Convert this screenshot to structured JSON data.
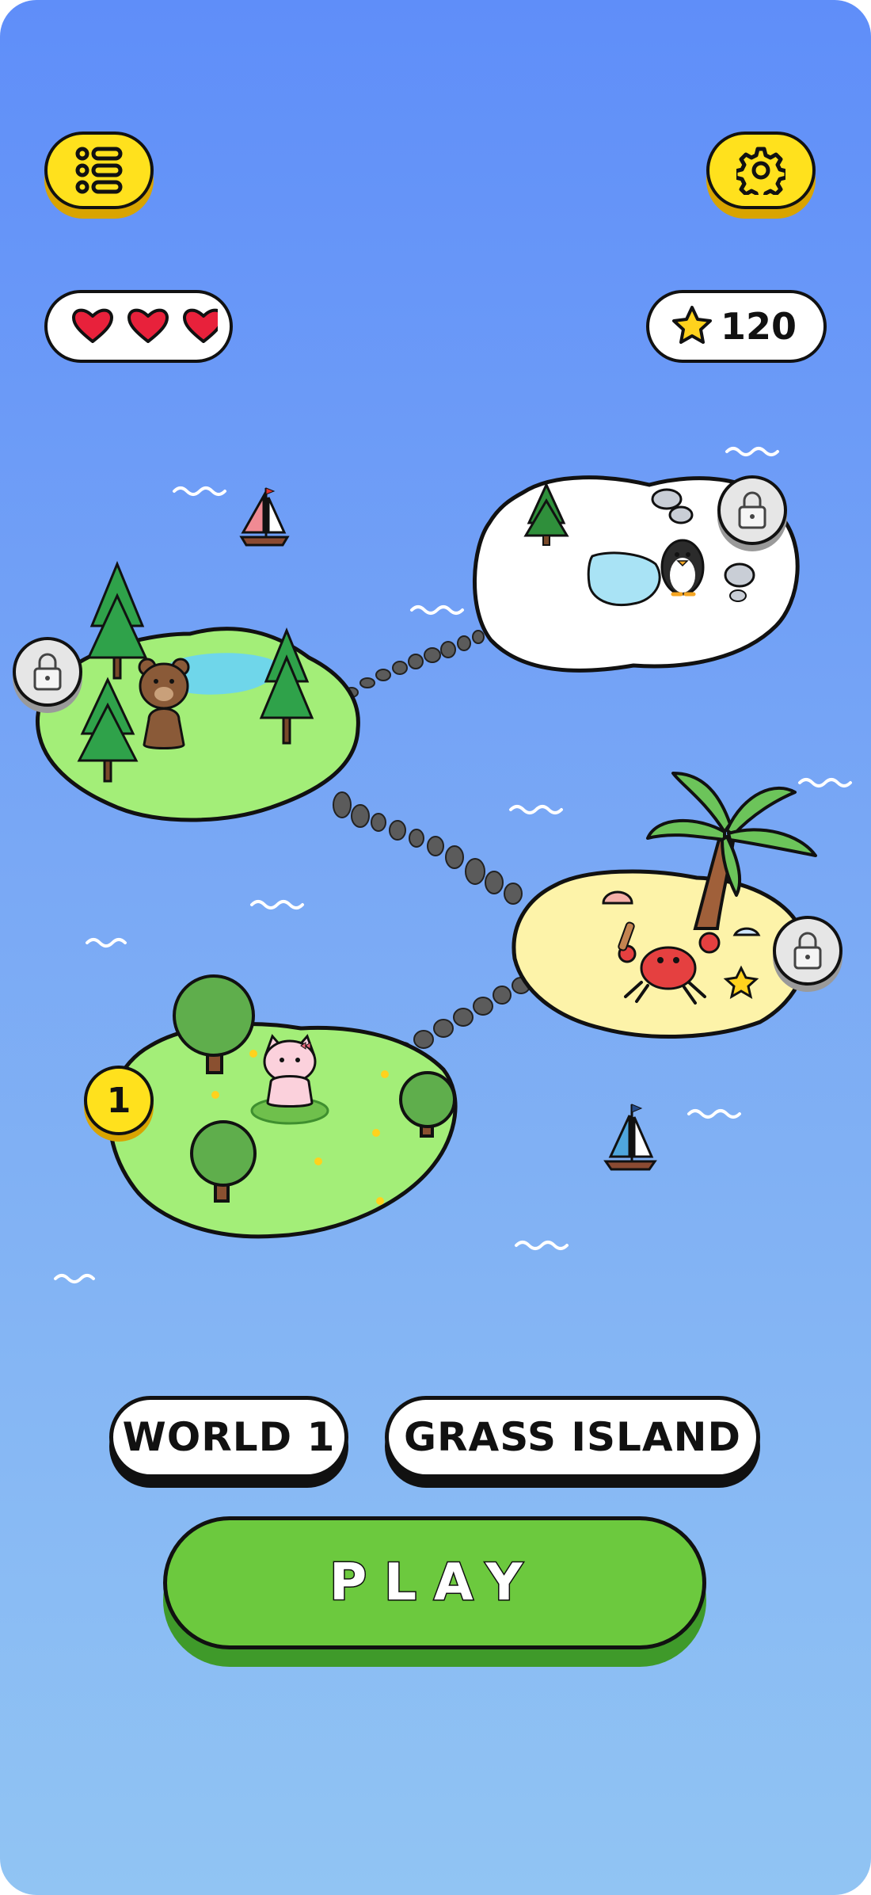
{
  "hud": {
    "menu_icon": "menu-icon",
    "settings_icon": "gear-icon",
    "lives": 3,
    "score": "120"
  },
  "map": {
    "islands": [
      {
        "name": "grass",
        "level_label": "1",
        "status": "current"
      },
      {
        "name": "forest",
        "status": "locked"
      },
      {
        "name": "beach",
        "status": "locked"
      },
      {
        "name": "snow",
        "status": "locked"
      }
    ]
  },
  "world": {
    "number_label": "WORLD 1",
    "name_label": "GRASS ISLAND"
  },
  "play": {
    "label": "PLAY"
  },
  "colors": {
    "accent_yellow": "#ffe11d",
    "play_green": "#6cc93e",
    "heart_red": "#e8213b",
    "sky_top": "#5f8ef9",
    "sky_bottom": "#91c4f3"
  }
}
